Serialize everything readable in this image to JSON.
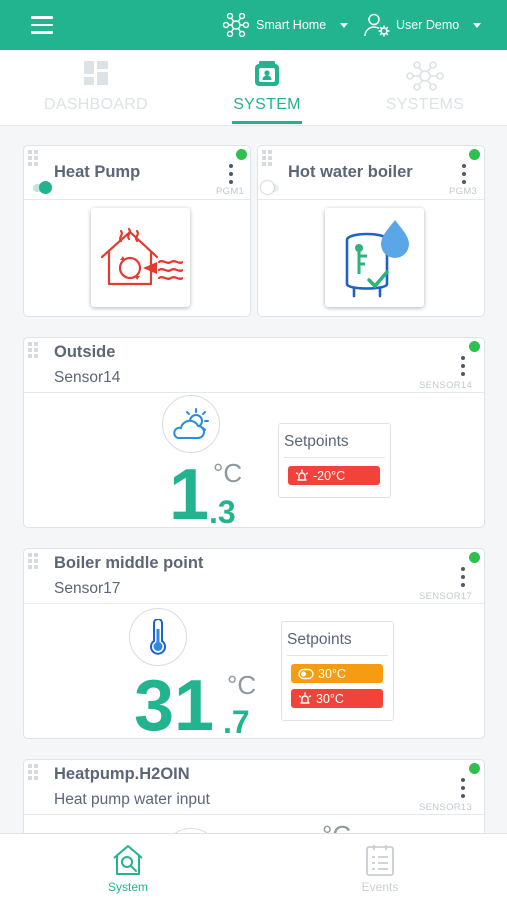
{
  "topbar": {
    "menu_icon": "hamburger-icon",
    "home_selector": {
      "label": "Smart Home",
      "icon": "network-icon"
    },
    "user_selector": {
      "label": "User Demo",
      "icon": "user-settings-icon"
    }
  },
  "tabs": [
    {
      "label": "DASHBOARD",
      "icon": "dashboard-icon",
      "active": false
    },
    {
      "label": "SYSTEM",
      "icon": "system-icon",
      "active": true
    },
    {
      "label": "SYSTEMS",
      "icon": "network-icon",
      "active": false
    }
  ],
  "devices": [
    {
      "title": "Heat Pump",
      "code": "PGM1",
      "toggle_on": true,
      "status_color": "#2fbf4f",
      "icon": "heat-pump-icon"
    },
    {
      "title": "Hot water boiler",
      "code": "PGM3",
      "toggle_on": false,
      "status_color": "#2fbf4f",
      "icon": "water-boiler-icon"
    }
  ],
  "sensors": [
    {
      "title": "Outside",
      "subtitle": "Sensor14",
      "code": "SENSOR14",
      "icon": "weather-icon",
      "value_int": "1",
      "value_dec": ".3",
      "unit": "°C",
      "setpoints_label": "Setpoints",
      "setpoints": [
        {
          "text": "-20°C",
          "icon": "alarm-icon",
          "color": "#f2433a"
        }
      ]
    },
    {
      "title": "Boiler middle point",
      "subtitle": "Sensor17",
      "code": "SENSOR17",
      "icon": "thermometer-icon",
      "value_int": "31",
      "value_dec": ".7",
      "unit": "°C",
      "setpoints_label": "Setpoints",
      "setpoints": [
        {
          "text": "30°C",
          "icon": "toggle-icon",
          "color": "#f59c12"
        },
        {
          "text": "30°C",
          "icon": "alarm-icon",
          "color": "#f2433a"
        }
      ]
    },
    {
      "title": "Heatpump.H2OIN",
      "subtitle": "Heat pump water input",
      "code": "SENSOR13",
      "unit": "°C"
    }
  ],
  "bottom_nav": [
    {
      "label": "System",
      "icon": "home-search-icon",
      "active": true
    },
    {
      "label": "Events",
      "icon": "events-list-icon",
      "active": false
    }
  ],
  "colors": {
    "accent": "#21b48f",
    "alarm": "#f2433a",
    "warning": "#f59c12",
    "online": "#2fbf4f"
  }
}
